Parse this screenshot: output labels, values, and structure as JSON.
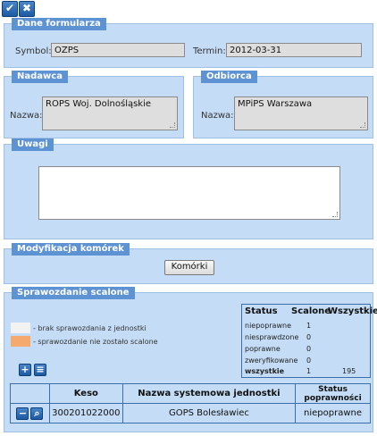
{
  "toolbar": {
    "confirm_icon": "check-icon",
    "close_icon": "close-icon",
    "confirm_glyph": "✔",
    "close_glyph": "✖"
  },
  "form": {
    "legend": "Dane formularza",
    "symbol_label": "Symbol:",
    "symbol_value": "OZPS",
    "termin_label": "Termin:",
    "termin_value": "2012-03-31"
  },
  "sender": {
    "legend": "Nadawca",
    "name_label": "Nazwa:",
    "name_value": "ROPS Woj. Dolnośląskie"
  },
  "recipient": {
    "legend": "Odbiorca",
    "name_label": "Nazwa:",
    "name_value": "MPiPS Warszawa"
  },
  "notes": {
    "legend": "Uwagi",
    "value": ""
  },
  "cells": {
    "legend": "Modyfikacja komórek",
    "button_label": "Komórki"
  },
  "merged": {
    "legend": "Sprawozdanie scalone",
    "legend_items": [
      {
        "color": "#f2f2f2",
        "text": "- brak sprawozdania z jednostki"
      },
      {
        "color": "#f5a96e",
        "text": "- sprawozdanie nie zostało scalone"
      }
    ],
    "status_table": {
      "headers": [
        "Status",
        "Scalone",
        "Wszystkie"
      ],
      "rows": [
        {
          "status": "niepoprawne",
          "scalone": "1",
          "wszystkie": ""
        },
        {
          "status": "niesprawdzone",
          "scalone": "0",
          "wszystkie": ""
        },
        {
          "status": "poprawne",
          "scalone": "0",
          "wszystkie": ""
        },
        {
          "status": "zweryfikowane",
          "scalone": "0",
          "wszystkie": ""
        },
        {
          "status": "wszystkie",
          "scalone": "1",
          "wszystkie": "195"
        }
      ]
    },
    "grid": {
      "headers": [
        "",
        "Keso",
        "Nazwa systemowa jednostki",
        "Status poprawności"
      ],
      "rows": [
        {
          "keso": "300201022000",
          "name": "GOPS Bolesławiec",
          "status": "niepoprawne"
        }
      ]
    }
  }
}
